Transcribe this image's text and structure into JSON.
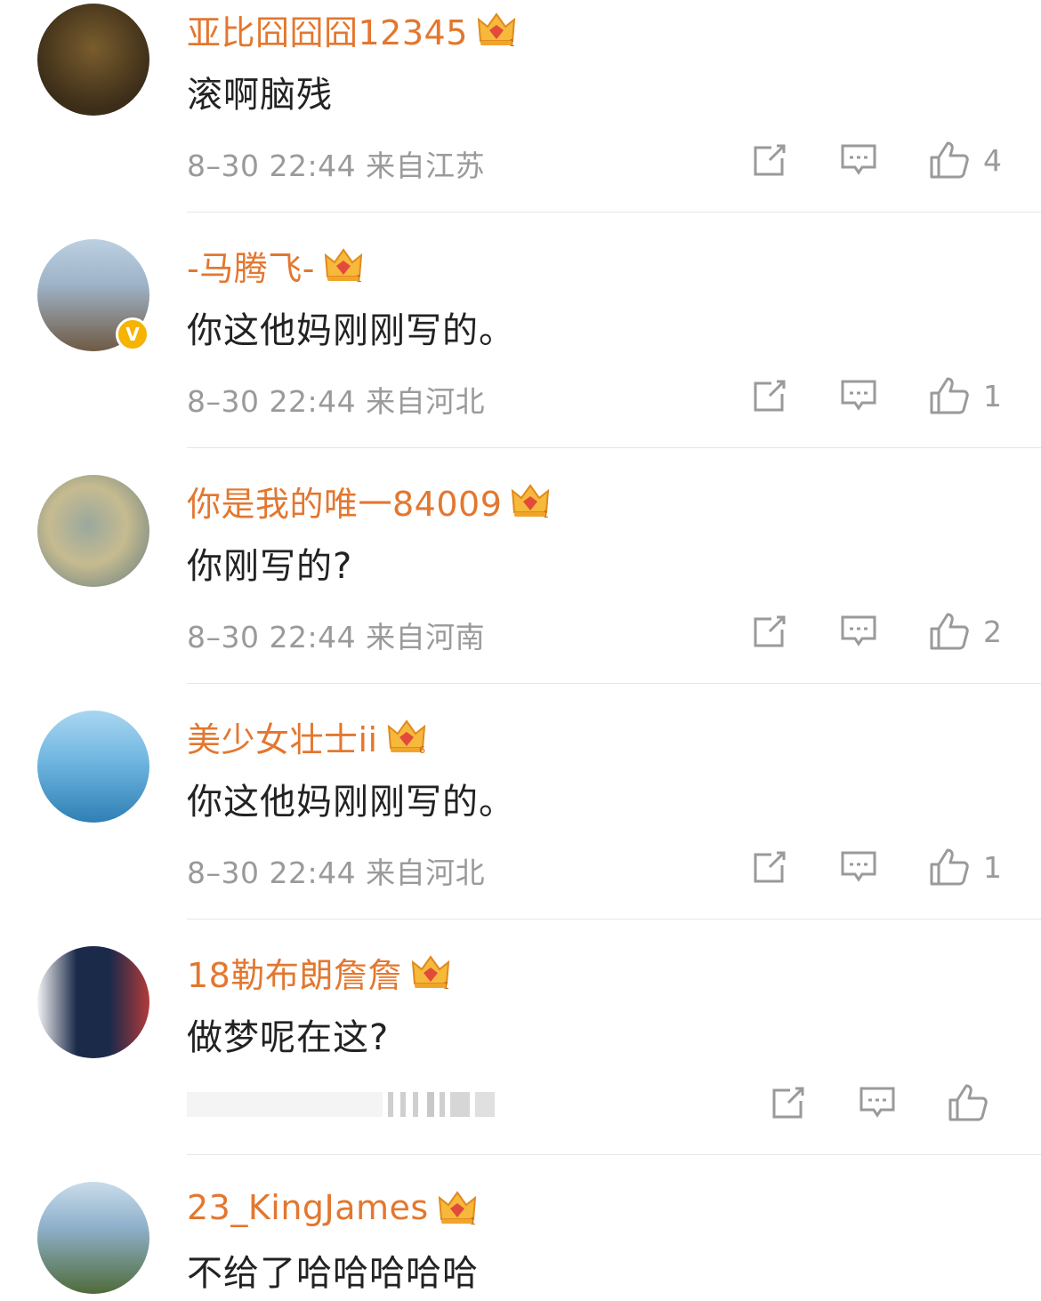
{
  "comments": [
    {
      "username": "亚比囧囧囧12345",
      "crown_level": "1",
      "text": "滚啊脑残",
      "meta": "8–30 22:44 来自江苏",
      "likes": "4",
      "verified": false,
      "avatar_colors": [
        "#3b2d18",
        "#7a5d2e"
      ]
    },
    {
      "username": "-马腾飞-",
      "crown_level": "1",
      "text": "你这他妈刚刚写的。",
      "meta": "8–30 22:44 来自河北",
      "likes": "1",
      "verified": true,
      "avatar_colors": [
        "#9fb3c8",
        "#6f5a44"
      ]
    },
    {
      "username": "你是我的唯一84009",
      "crown_level": "1",
      "text": "你刚写的?",
      "meta": "8–30 22:44 来自河南",
      "likes": "2",
      "verified": false,
      "avatar_colors": [
        "#c6bb90",
        "#5f7a80"
      ]
    },
    {
      "username": "美少女壮士ii",
      "crown_level": "6",
      "text": "你这他妈刚刚写的。",
      "meta": "8–30 22:44 来自河北",
      "likes": "1",
      "verified": false,
      "avatar_colors": [
        "#6fb6e0",
        "#2f7fb5"
      ]
    },
    {
      "username": "18勒布朗詹詹",
      "crown_level": "1",
      "text": "做梦呢在这?",
      "meta": "",
      "likes": "",
      "verified": false,
      "avatar_colors": [
        "#1c2a4a",
        "#b23a3a"
      ]
    },
    {
      "username": "23_KingJames",
      "crown_level": "1",
      "text": "不给了哈哈哈哈哈",
      "meta": "",
      "likes": "",
      "verified": false,
      "avatar_colors": [
        "#8fb1cc",
        "#4f6b3a"
      ]
    }
  ],
  "colors": {
    "username": "#e3772f",
    "text": "#222222",
    "meta": "#9a9a9a",
    "verified_badge": "#f5b400",
    "divider": "#e6e6e6"
  },
  "icons": [
    "share-icon",
    "reply-icon",
    "like-icon",
    "crown-icon",
    "verified-icon"
  ]
}
